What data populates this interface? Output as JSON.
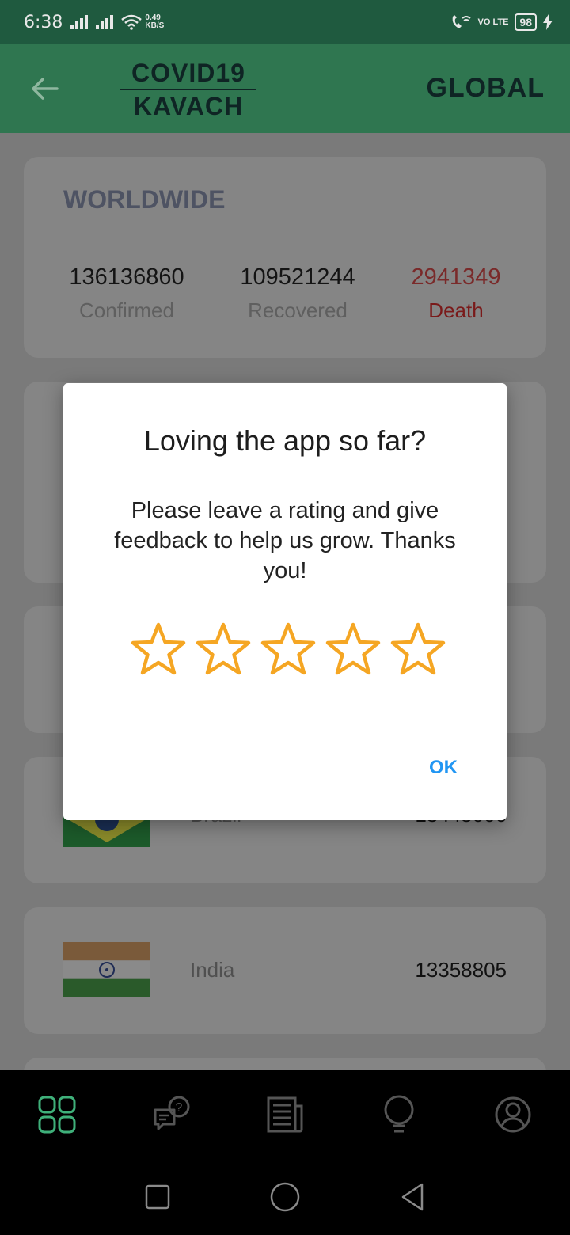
{
  "status_bar": {
    "time": "6:38",
    "network_speed": "0.49",
    "network_unit": "KB/S",
    "volte": "VO LTE",
    "battery": "98"
  },
  "app_bar": {
    "logo_line1": "COVID19",
    "logo_line2": "KAVACH",
    "title": "GLOBAL"
  },
  "worldwide": {
    "title": "WORLDWIDE",
    "confirmed_value": "136136860",
    "confirmed_label": "Confirmed",
    "recovered_value": "109521244",
    "recovered_label": "Recovered",
    "death_value": "2941349",
    "death_label": "Death"
  },
  "countries": [
    {
      "name": "Brazil",
      "count": "13445006"
    },
    {
      "name": "India",
      "count": "13358805"
    }
  ],
  "dialog": {
    "title": "Loving the app so far?",
    "message": "Please leave a rating and give feedback to help us grow. Thanks you!",
    "rating": 0,
    "rating_max": 5,
    "ok_label": "OK"
  },
  "colors": {
    "accent": "#2f7650",
    "star": "#f5a623",
    "ok": "#2196f3",
    "death": "#c62828"
  }
}
